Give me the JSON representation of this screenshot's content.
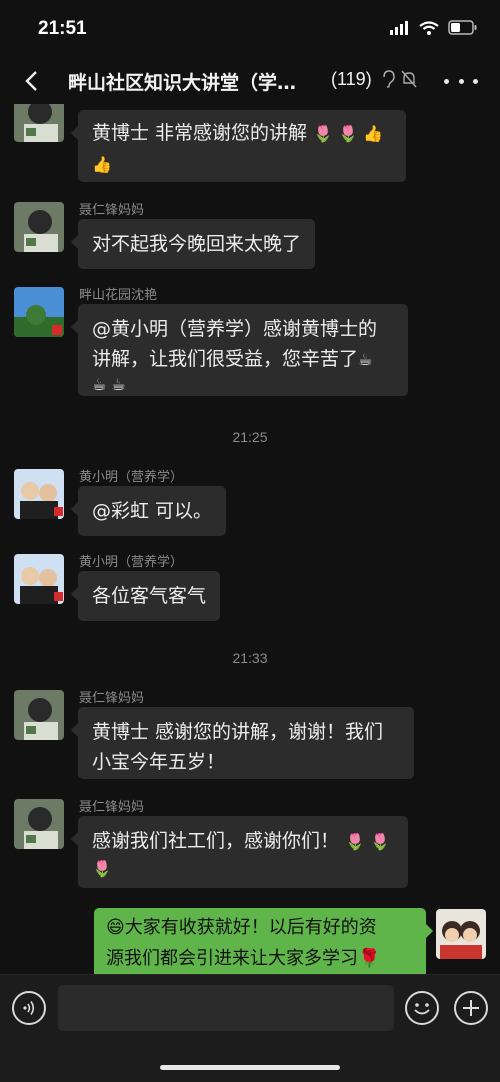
{
  "status": {
    "time": "21:51"
  },
  "header": {
    "title": "畔山社区知识大讲堂（学…",
    "member_count": "(119)"
  },
  "messages": [
    {
      "sender": "",
      "text": "黄博士  非常感谢您的讲解",
      "emojis": "🌷 🌷 👍 👍"
    },
    {
      "sender": "聂仁锋妈妈",
      "text": "对不起我今晚回来太晚了"
    },
    {
      "sender": "畔山花园沈艳",
      "line1": "@黄小明（营养学）感谢黄博士的",
      "line2": "讲解，让我们很受益，您辛苦了",
      "emojis1": "☕",
      "emojis2": "☕ ☕"
    },
    {
      "timestamp": "21:25"
    },
    {
      "sender": "黄小明（营养学）",
      "text": "@彩虹 可以。"
    },
    {
      "sender": "黄小明（营养学）",
      "text": "各位客气客气"
    },
    {
      "timestamp": "21:33"
    },
    {
      "sender": "聂仁锋妈妈",
      "line1": "黄博士  感谢您的讲解，谢谢！我们",
      "line2": "小宝今年五岁！"
    },
    {
      "sender": "聂仁锋妈妈",
      "text": "感谢我们社工们，感谢你们！",
      "emojis1": "🌷 🌷",
      "emojis2": "🌷"
    },
    {
      "line1": "大家有收获就好！以后有好的资",
      "line2": "源我们都会引进来让大家多学习",
      "lead_emoji": "😄",
      "tail_emoji": "🌹"
    }
  ],
  "colors": {
    "background": "#111111",
    "bubble": "#2c2c2c",
    "self_bubble": "#5fb54a"
  },
  "icons": [
    "back-icon",
    "ear-icon",
    "mute-bell-icon",
    "more-icon",
    "voice-icon",
    "emoji-icon",
    "plus-icon"
  ]
}
